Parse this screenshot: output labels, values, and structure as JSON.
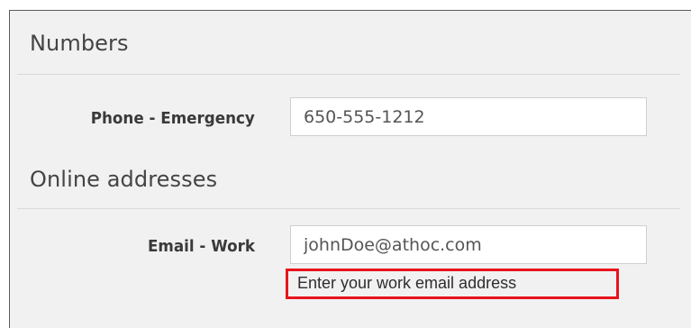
{
  "sections": {
    "numbers": {
      "title": "Numbers",
      "fields": [
        {
          "label": "Phone - Emergency",
          "value": "650-555-1212"
        }
      ]
    },
    "online": {
      "title": "Online addresses",
      "fields": [
        {
          "label": "Email - Work",
          "value": "johnDoe@athoc.com",
          "helper": "Enter your work email address"
        }
      ]
    }
  },
  "colors": {
    "panel_background": "#f1f1f1",
    "highlight_border": "#e8141c"
  }
}
